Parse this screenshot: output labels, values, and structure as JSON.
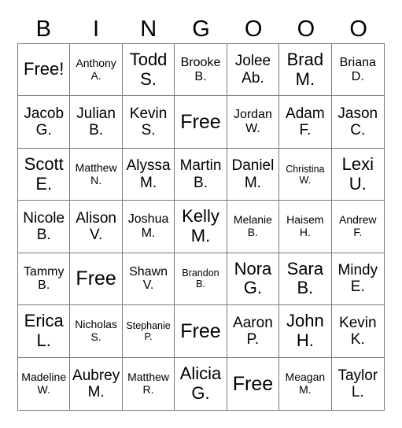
{
  "header": [
    "B",
    "I",
    "N",
    "G",
    "O",
    "O",
    "O"
  ],
  "cells": [
    [
      {
        "text": "Free!",
        "size": "l"
      },
      {
        "text": "Anthony\nA.",
        "size": "xs"
      },
      {
        "text": "Todd\nS.",
        "size": "l"
      },
      {
        "text": "Brooke\nB.",
        "size": "s"
      },
      {
        "text": "Jolee\nAb.",
        "size": "m"
      },
      {
        "text": "Brad\nM.",
        "size": "l"
      },
      {
        "text": "Briana\nD.",
        "size": "s"
      }
    ],
    [
      {
        "text": "Jacob\nG.",
        "size": "m"
      },
      {
        "text": "Julian\nB.",
        "size": "m"
      },
      {
        "text": "Kevin\nS.",
        "size": "m"
      },
      {
        "text": "Free",
        "size": "xl"
      },
      {
        "text": "Jordan\nW.",
        "size": "s"
      },
      {
        "text": "Adam\nF.",
        "size": "m"
      },
      {
        "text": "Jason\nC.",
        "size": "m"
      }
    ],
    [
      {
        "text": "Scott\nE.",
        "size": "l"
      },
      {
        "text": "Matthew\nN.",
        "size": "xs"
      },
      {
        "text": "Alyssa\nM.",
        "size": "m"
      },
      {
        "text": "Martin\nB.",
        "size": "m"
      },
      {
        "text": "Daniel\nM.",
        "size": "m"
      },
      {
        "text": "Christina\nW.",
        "size": "xxs"
      },
      {
        "text": "Lexi\nU.",
        "size": "l"
      }
    ],
    [
      {
        "text": "Nicole\nB.",
        "size": "m"
      },
      {
        "text": "Alison\nV.",
        "size": "m"
      },
      {
        "text": "Joshua\nM.",
        "size": "s"
      },
      {
        "text": "Kelly\nM.",
        "size": "l"
      },
      {
        "text": "Melanie\nB.",
        "size": "xs"
      },
      {
        "text": "Haisem\nH.",
        "size": "xs"
      },
      {
        "text": "Andrew\nF.",
        "size": "xs"
      }
    ],
    [
      {
        "text": "Tammy\nB.",
        "size": "s"
      },
      {
        "text": "Free",
        "size": "xl"
      },
      {
        "text": "Shawn\nV.",
        "size": "s"
      },
      {
        "text": "Brandon\nB.",
        "size": "xxs"
      },
      {
        "text": "Nora\nG.",
        "size": "l"
      },
      {
        "text": "Sara\nB.",
        "size": "l"
      },
      {
        "text": "Mindy\nE.",
        "size": "m"
      }
    ],
    [
      {
        "text": "Erica\nL.",
        "size": "l"
      },
      {
        "text": "Nicholas\nS.",
        "size": "xs"
      },
      {
        "text": "Stephanie\nP.",
        "size": "xxs"
      },
      {
        "text": "Free",
        "size": "xl"
      },
      {
        "text": "Aaron\nP.",
        "size": "m"
      },
      {
        "text": "John\nH.",
        "size": "l"
      },
      {
        "text": "Kevin\nK.",
        "size": "m"
      }
    ],
    [
      {
        "text": "Madeline\nW.",
        "size": "xs"
      },
      {
        "text": "Aubrey\nM.",
        "size": "m"
      },
      {
        "text": "Matthew\nR.",
        "size": "xs"
      },
      {
        "text": "Alicia\nG.",
        "size": "l"
      },
      {
        "text": "Free",
        "size": "xl"
      },
      {
        "text": "Meagan\nM.",
        "size": "xs"
      },
      {
        "text": "Taylor\nL.",
        "size": "m"
      }
    ]
  ]
}
